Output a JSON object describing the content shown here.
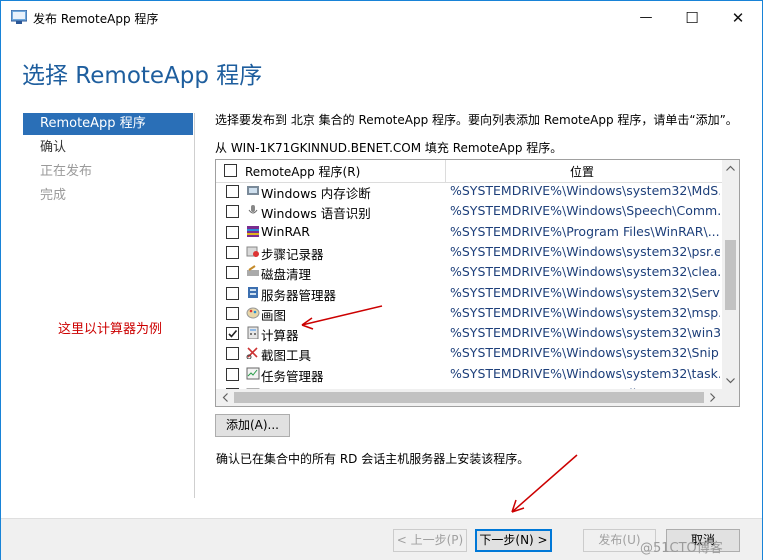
{
  "window": {
    "title": "发布 RemoteApp 程序",
    "minimize_glyph": "—",
    "maximize_glyph": "☐",
    "close_glyph": "✕"
  },
  "heading": "选择 RemoteApp 程序",
  "nav": {
    "items": [
      {
        "label": "RemoteApp 程序",
        "state": "active"
      },
      {
        "label": "确认",
        "state": "normal"
      },
      {
        "label": "正在发布",
        "state": "disabled"
      },
      {
        "label": "完成",
        "state": "disabled"
      }
    ]
  },
  "main": {
    "description": "选择要发布到 北京 集合的 RemoteApp 程序。要向列表添加 RemoteApp 程序，请单击“添加”。",
    "from_text": "从 WIN-1K71GKINNUD.BENET.COM 填充 RemoteApp 程序。",
    "grid": {
      "columns": [
        "RemoteApp 程序(R)",
        "位置"
      ],
      "rows": [
        {
          "name": "Windows 内存诊断",
          "path": "%SYSTEMDRIVE%\\Windows\\system32\\MdS...",
          "checked": false,
          "icon": "memory-diagnostic-icon"
        },
        {
          "name": "Windows 语音识别",
          "path": "%SYSTEMDRIVE%\\Windows\\Speech\\Comm...",
          "checked": false,
          "icon": "microphone-icon"
        },
        {
          "name": "WinRAR",
          "path": "%SYSTEMDRIVE%\\Program Files\\WinRAR\\...",
          "checked": false,
          "icon": "winrar-icon"
        },
        {
          "name": "步骤记录器",
          "path": "%SYSTEMDRIVE%\\Windows\\system32\\psr.e...",
          "checked": false,
          "icon": "steps-recorder-icon"
        },
        {
          "name": "磁盘清理",
          "path": "%SYSTEMDRIVE%\\Windows\\system32\\clea...",
          "checked": false,
          "icon": "disk-cleanup-icon"
        },
        {
          "name": "服务器管理器",
          "path": "%SYSTEMDRIVE%\\Windows\\system32\\Serv...",
          "checked": false,
          "icon": "server-manager-icon"
        },
        {
          "name": "画图",
          "path": "%SYSTEMDRIVE%\\Windows\\system32\\msp...",
          "checked": false,
          "icon": "paint-icon"
        },
        {
          "name": "计算器",
          "path": "%SYSTEMDRIVE%\\Windows\\system32\\win3...",
          "checked": true,
          "icon": "calculator-icon"
        },
        {
          "name": "截图工具",
          "path": "%SYSTEMDRIVE%\\Windows\\system32\\Snip...",
          "checked": false,
          "icon": "snipping-tool-icon"
        },
        {
          "name": "任务管理器",
          "path": "%SYSTEMDRIVE%\\Windows\\system32\\task...",
          "checked": false,
          "icon": "task-manager-icon"
        },
        {
          "name": "(数学输入)面板",
          "path": "%SYSTEMDRIVE%\\Program Files\\Comm...",
          "checked": false,
          "icon": "math-input-icon"
        }
      ]
    },
    "add_button": "添加(A)...",
    "confirm_text": "确认已在集合中的所有 RD 会话主机服务器上安装该程序。",
    "annotation": "这里以计算器为例"
  },
  "footer": {
    "prev": "< 上一步(P)",
    "next": "下一步(N) >",
    "publish": "发布(U)",
    "cancel": "取消"
  },
  "watermark": "@51CTO博客",
  "colors": {
    "accent": "#2a6fb7",
    "heading": "#1e5e9e",
    "annotation": "#cc0000"
  }
}
